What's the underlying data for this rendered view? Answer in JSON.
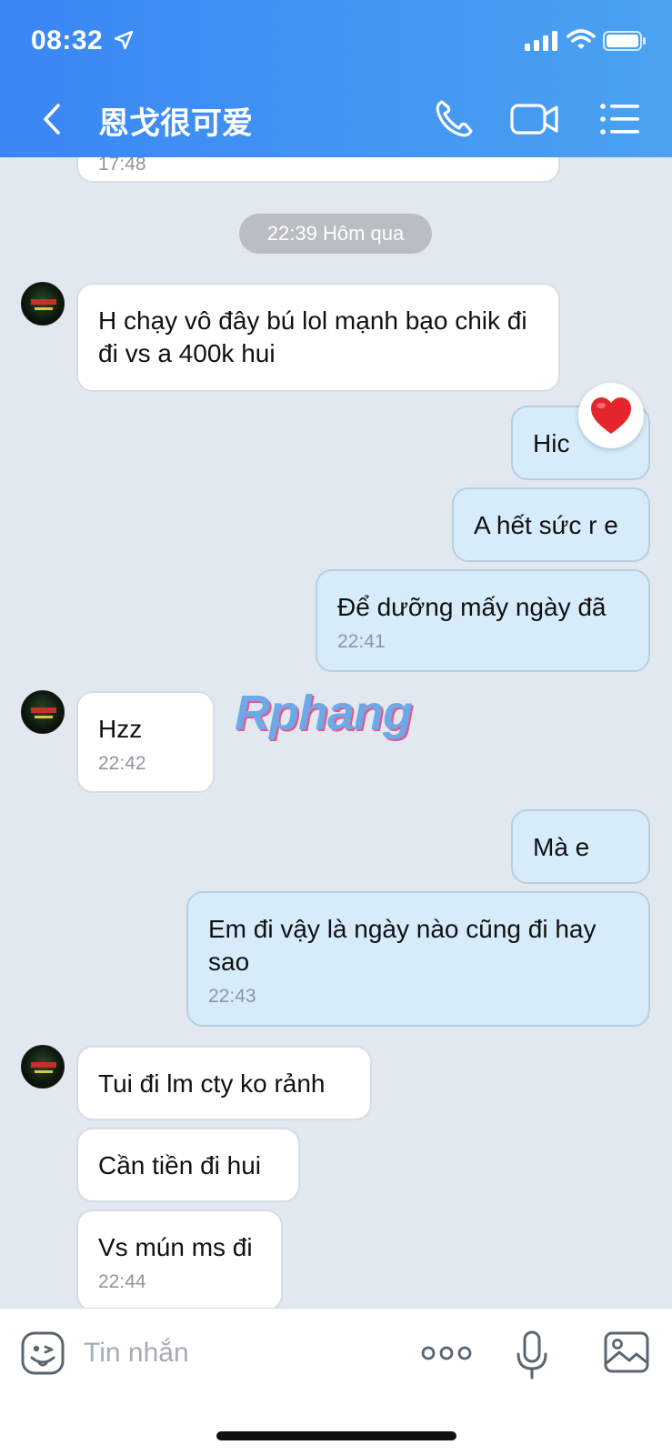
{
  "status": {
    "time": "08:32"
  },
  "header": {
    "title": "恩戈很可爱"
  },
  "chat": {
    "top_partial_time": "17:48",
    "separator": "22:39 Hôm qua",
    "messages": [
      {
        "dir": "in",
        "text": "H chạy vô đây bú lol mạnh bạo chik đi đi vs a 400k hui",
        "time": ""
      },
      {
        "dir": "out",
        "text": "Hic",
        "time": "",
        "reaction": "heart"
      },
      {
        "dir": "out",
        "text": "A hết sức r e",
        "time": ""
      },
      {
        "dir": "out",
        "text": "Để dưỡng mấy ngày đã",
        "time": "22:41"
      },
      {
        "dir": "in",
        "text": "Hzz",
        "time": "22:42"
      },
      {
        "dir": "out",
        "text": "Mà e",
        "time": ""
      },
      {
        "dir": "out",
        "text": "Em đi vậy là ngày nào cũng đi hay sao",
        "time": "22:43"
      },
      {
        "dir": "in",
        "text": "Tui đi lm cty ko rảnh",
        "time": ""
      },
      {
        "dir": "in",
        "text": "Cần tiền đi hui",
        "time": ""
      },
      {
        "dir": "in",
        "text": "Vs mún ms đi",
        "time": "22:44"
      }
    ],
    "watermark": "Rphang"
  },
  "input": {
    "placeholder": "Tin nhắn"
  },
  "icons": {
    "back": "chevron-left-icon",
    "call": "phone-icon",
    "video": "video-camera-icon",
    "menu": "list-menu-icon",
    "emoji": "emoji-sticker-icon",
    "more": "more-dots-icon",
    "mic": "microphone-icon",
    "image": "image-icon",
    "reaction": "heart-icon"
  },
  "colors": {
    "header_start": "#3a86f5",
    "header_end": "#4aa2f0",
    "out_bubble": "#d6ecfb",
    "in_bubble": "#ffffff",
    "chat_bg": "#e2e8f0"
  }
}
